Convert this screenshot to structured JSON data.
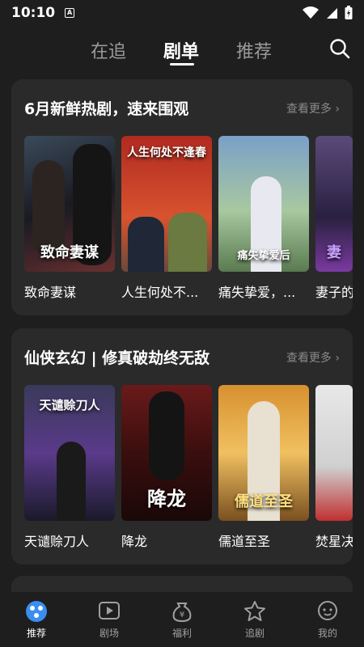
{
  "status": {
    "time": "10:10",
    "a_label": "A"
  },
  "nav": {
    "tabs": [
      {
        "label": "在追"
      },
      {
        "label": "剧单"
      },
      {
        "label": "推荐"
      }
    ],
    "active_tab": "剧单"
  },
  "sections": [
    {
      "title": "6月新鲜热剧，速来围观",
      "more": "查看更多",
      "items": [
        {
          "caption": "致命妻谋",
          "poster_text": "致命妻谋"
        },
        {
          "caption": "人生何处不...",
          "poster_text": "人生何处不逢春"
        },
        {
          "caption": "痛失挚爱，...",
          "poster_text": "痛失挚爱后"
        },
        {
          "caption": "妻子的",
          "poster_text": "妻"
        }
      ]
    },
    {
      "title": "仙侠玄幻 | 修真破劫终无敌",
      "more": "查看更多",
      "items": [
        {
          "caption": "天谴赊刀人",
          "poster_text": "天谴赊刀人"
        },
        {
          "caption": "降龙",
          "poster_text": "降龙"
        },
        {
          "caption": "儒道至圣",
          "poster_text": "儒道至圣"
        },
        {
          "caption": "焚星决",
          "poster_text": ""
        }
      ]
    }
  ],
  "bottom": [
    {
      "label": "推荐",
      "icon": "recommend-icon"
    },
    {
      "label": "剧场",
      "icon": "play-icon"
    },
    {
      "label": "福利",
      "icon": "welfare-icon"
    },
    {
      "label": "追剧",
      "icon": "follow-icon"
    },
    {
      "label": "我的",
      "icon": "profile-icon"
    }
  ]
}
